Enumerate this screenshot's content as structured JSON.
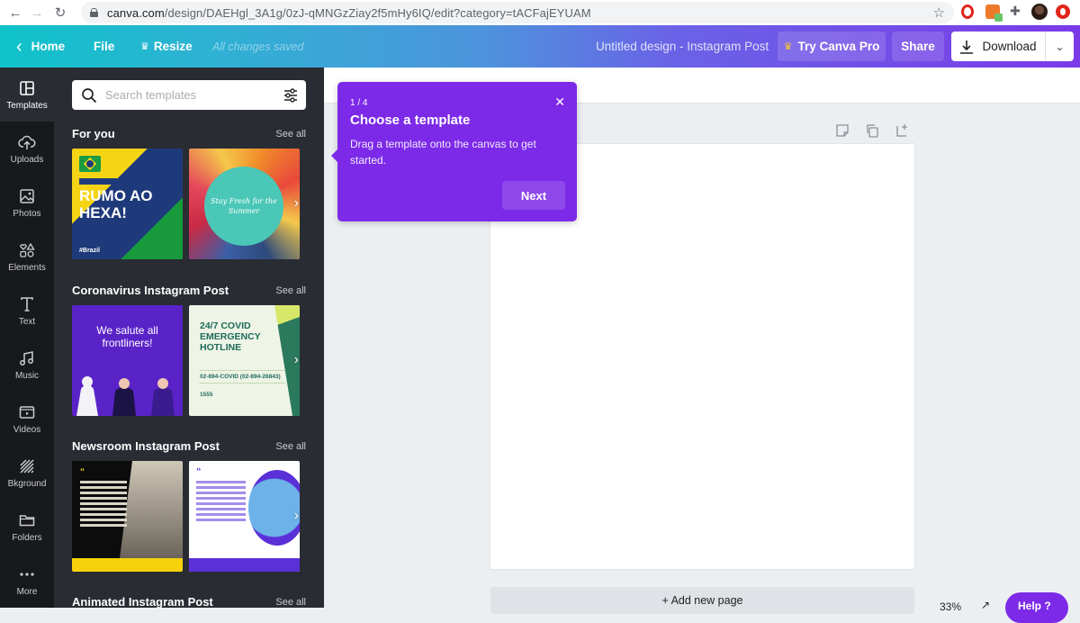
{
  "browser": {
    "url_host": "canva.com",
    "url_path": "/design/DAEHgl_3A1g/0zJ-qMNGzZiay2f5mHy6IQ/edit?category=tACFajEYUAM",
    "icons": [
      "back-icon",
      "forward-icon",
      "reload-icon",
      "lock-icon",
      "bookmark-star-icon",
      "opera-extension-icon",
      "extension-icon",
      "puzzle-extensions-icon",
      "profile-avatar",
      "opera-icon"
    ]
  },
  "topbar": {
    "home_label": "Home",
    "file_label": "File",
    "resize_label": "Resize",
    "save_status": "All changes saved",
    "design_title": "Untitled design - Instagram Post",
    "pro_label": "Try Canva Pro",
    "share_label": "Share",
    "download_label": "Download"
  },
  "rail": {
    "items": [
      {
        "label": "Templates",
        "icon": "templates-icon",
        "active": true
      },
      {
        "label": "Uploads",
        "icon": "upload-cloud-icon"
      },
      {
        "label": "Photos",
        "icon": "photo-icon"
      },
      {
        "label": "Elements",
        "icon": "elements-shapes-icon"
      },
      {
        "label": "Text",
        "icon": "text-icon"
      },
      {
        "label": "Music",
        "icon": "music-note-icon"
      },
      {
        "label": "Videos",
        "icon": "video-icon"
      },
      {
        "label": "Bkground",
        "icon": "background-hatch-icon"
      },
      {
        "label": "Folders",
        "icon": "folder-icon"
      },
      {
        "label": "More",
        "icon": "more-dots-icon"
      }
    ]
  },
  "panel": {
    "search_placeholder": "Search templates",
    "sections": [
      {
        "title": "For you",
        "see_all": "See all",
        "thumbs": [
          {
            "headline": "RUMO AO HEXA!",
            "tag": "#Brazil"
          },
          {
            "headline": "Stay Fresh for the Summer"
          }
        ]
      },
      {
        "title": "Coronavirus Instagram Post",
        "see_all": "See all",
        "thumbs": [
          {
            "headline": "We salute all frontliners!"
          },
          {
            "headline": "24/7 COVID EMERGENCY HOTLINE",
            "phone": "02-894-COVID (02-894-26843)",
            "short": "1555"
          }
        ]
      },
      {
        "title": "Newsroom Instagram Post",
        "see_all": "See all",
        "thumbs": [
          {
            "quote_mark": "“"
          },
          {
            "quote_mark": "“"
          }
        ]
      },
      {
        "title": "Animated Instagram Post",
        "see_all": "See all"
      }
    ]
  },
  "tooltip": {
    "step": "1 / 4",
    "title": "Choose a template",
    "body": "Drag a template onto the canvas to get started.",
    "next_label": "Next"
  },
  "editor": {
    "add_page_label": "+ Add new page",
    "zoom_level": "33%",
    "help_label": "Help ?"
  }
}
